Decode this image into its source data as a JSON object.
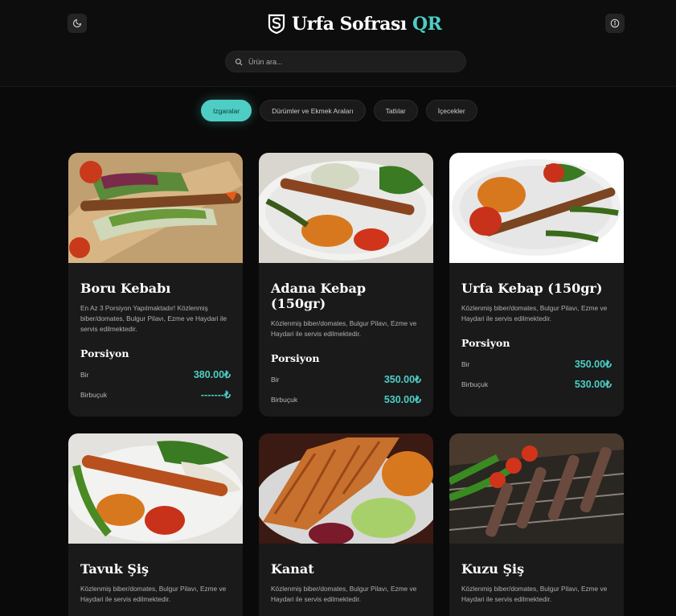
{
  "header": {
    "title_main": "Urfa Sofrası",
    "title_accent": "QR",
    "theme_icon": "moon-icon",
    "info_icon": "info-icon",
    "logo_icon": "shield-s-logo"
  },
  "search": {
    "placeholder": "Ürün ara...",
    "value": ""
  },
  "tabs": [
    {
      "label": "Izgaralar",
      "active": true
    },
    {
      "label": "Dürümler ve Ekmek Araları",
      "active": false
    },
    {
      "label": "Tatlılar",
      "active": false
    },
    {
      "label": "İçecekler",
      "active": false
    }
  ],
  "products": [
    {
      "name": "Boru Kebabı",
      "desc": "En Az 3 Porsiyon Yapılmaktadır! Közlenmiş biber/domates, Bulgur Pilavı, Ezme ve Haydari ile servis edilmektedir.",
      "portion_title": "Porsiyon",
      "prices": [
        {
          "label": "Bir",
          "value": "380.00₺"
        },
        {
          "label": "Birbuçuk",
          "value": "-------₺"
        }
      ]
    },
    {
      "name": "Adana Kebap (150gr)",
      "desc": "Közlenmiş biber/domates, Bulgur Pilavı, Ezme ve Haydari ile servis edilmektedir.",
      "portion_title": "Porsiyon",
      "prices": [
        {
          "label": "Bir",
          "value": "350.00₺"
        },
        {
          "label": "Birbuçuk",
          "value": "530.00₺"
        }
      ]
    },
    {
      "name": "Urfa Kebap (150gr)",
      "desc": "Közlenmiş biber/domates, Bulgur Pilavı, Ezme ve Haydari ile servis edilmektedir.",
      "portion_title": "Porsiyon",
      "prices": [
        {
          "label": "Bir",
          "value": "350.00₺"
        },
        {
          "label": "Birbuçuk",
          "value": "530.00₺"
        }
      ]
    },
    {
      "name": "Tavuk Şiş",
      "desc": "Közlenmiş biber/domates, Bulgur Pilavı, Ezme ve Haydari ile servis edilmektedir."
    },
    {
      "name": "Kanat",
      "desc": "Közlenmiş biber/domates, Bulgur Pilavı, Ezme ve Haydari ile servis edilmektedir."
    },
    {
      "name": "Kuzu Şiş",
      "desc": "Közlenmiş biber/domates, Bulgur Pilavı, Ezme ve Haydari ile servis edilmektedir."
    }
  ],
  "colors": {
    "accent": "#4ecdc4",
    "background": "#0a0a0a",
    "card": "#1a1a1a"
  }
}
